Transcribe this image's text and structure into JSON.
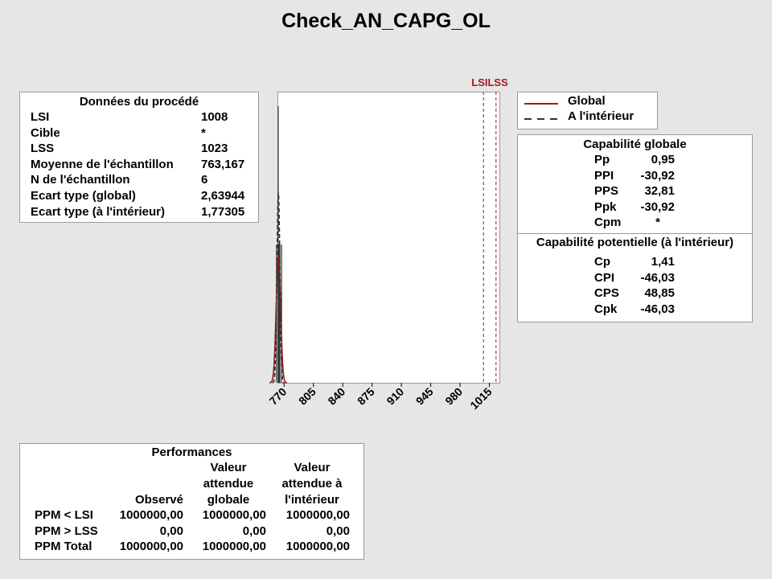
{
  "title": "Check_AN_CAPG_OL",
  "process": {
    "header": "Données du procédé",
    "rows": [
      {
        "label": "LSI",
        "value": "1008"
      },
      {
        "label": "Cible",
        "value": "*"
      },
      {
        "label": "LSS",
        "value": "1023"
      },
      {
        "label": "Moyenne de l'échantillon",
        "value": "763,167"
      },
      {
        "label": "N de l'échantillon",
        "value": "6"
      },
      {
        "label": "Ecart type (global)",
        "value": "2,63944"
      },
      {
        "label": "Ecart type (à l'intérieur)",
        "value": "1,77305"
      }
    ]
  },
  "legend": {
    "global": "Global",
    "within": "A l'intérieur",
    "global_color": "#9b1c1c",
    "within_color": "#333333"
  },
  "capability": {
    "global_header": "Capabilité globale",
    "global_rows": [
      {
        "label": "Pp",
        "value": "0,95"
      },
      {
        "label": "PPI",
        "value": "-30,92"
      },
      {
        "label": "PPS",
        "value": "32,81"
      },
      {
        "label": "Ppk",
        "value": "-30,92"
      },
      {
        "label": "Cpm",
        "value": "*"
      }
    ],
    "potential_header": "Capabilité potentielle (à l'intérieur)",
    "potential_rows": [
      {
        "label": "Cp",
        "value": "1,41"
      },
      {
        "label": "CPI",
        "value": "-46,03"
      },
      {
        "label": "CPS",
        "value": "48,85"
      },
      {
        "label": "Cpk",
        "value": "-46,03"
      }
    ]
  },
  "performance": {
    "header": "Performances",
    "col_headers": [
      "Observé",
      "Valeur attendue globale",
      "Valeur attendue à l'intérieur"
    ],
    "col_header_lines": [
      [
        "Observé"
      ],
      [
        "Valeur",
        "attendue",
        "globale"
      ],
      [
        "Valeur",
        "attendue à",
        "l'intérieur"
      ]
    ],
    "rows": [
      {
        "label": "PPM < LSI",
        "values": [
          "1000000,00",
          "1000000,00",
          "1000000,00"
        ]
      },
      {
        "label": "PPM > LSS",
        "values": [
          "0,00",
          "0,00",
          "0,00"
        ]
      },
      {
        "label": "PPM Total",
        "values": [
          "1000000,00",
          "1000000,00",
          "1000000,00"
        ]
      }
    ]
  },
  "chart_data": {
    "type": "bar",
    "xlim": [
      763,
      1027
    ],
    "ticks": [
      770,
      805,
      840,
      875,
      910,
      945,
      980,
      1015
    ],
    "tick_labels": [
      "770",
      "805",
      "840",
      "875",
      "910",
      "945",
      "980",
      "1015"
    ],
    "spec_lines": [
      {
        "name": "LSI",
        "x": 1008
      },
      {
        "name": "LSS",
        "x": 1023
      }
    ],
    "spec_label": "LSILSS",
    "histogram": {
      "bin_centers": [
        760,
        761,
        762,
        763,
        764,
        765,
        766
      ],
      "counts": [
        1,
        0,
        2,
        1,
        1,
        0,
        1
      ]
    },
    "curves": [
      {
        "name": "Global",
        "mean": 763.167,
        "sd": 2.63944,
        "style": "solid",
        "color": "#9b1c1c"
      },
      {
        "name": "A l'intérieur",
        "mean": 763.167,
        "sd": 1.77305,
        "style": "dashed",
        "color": "#333333"
      }
    ],
    "grid": false,
    "legend_position": "right"
  }
}
